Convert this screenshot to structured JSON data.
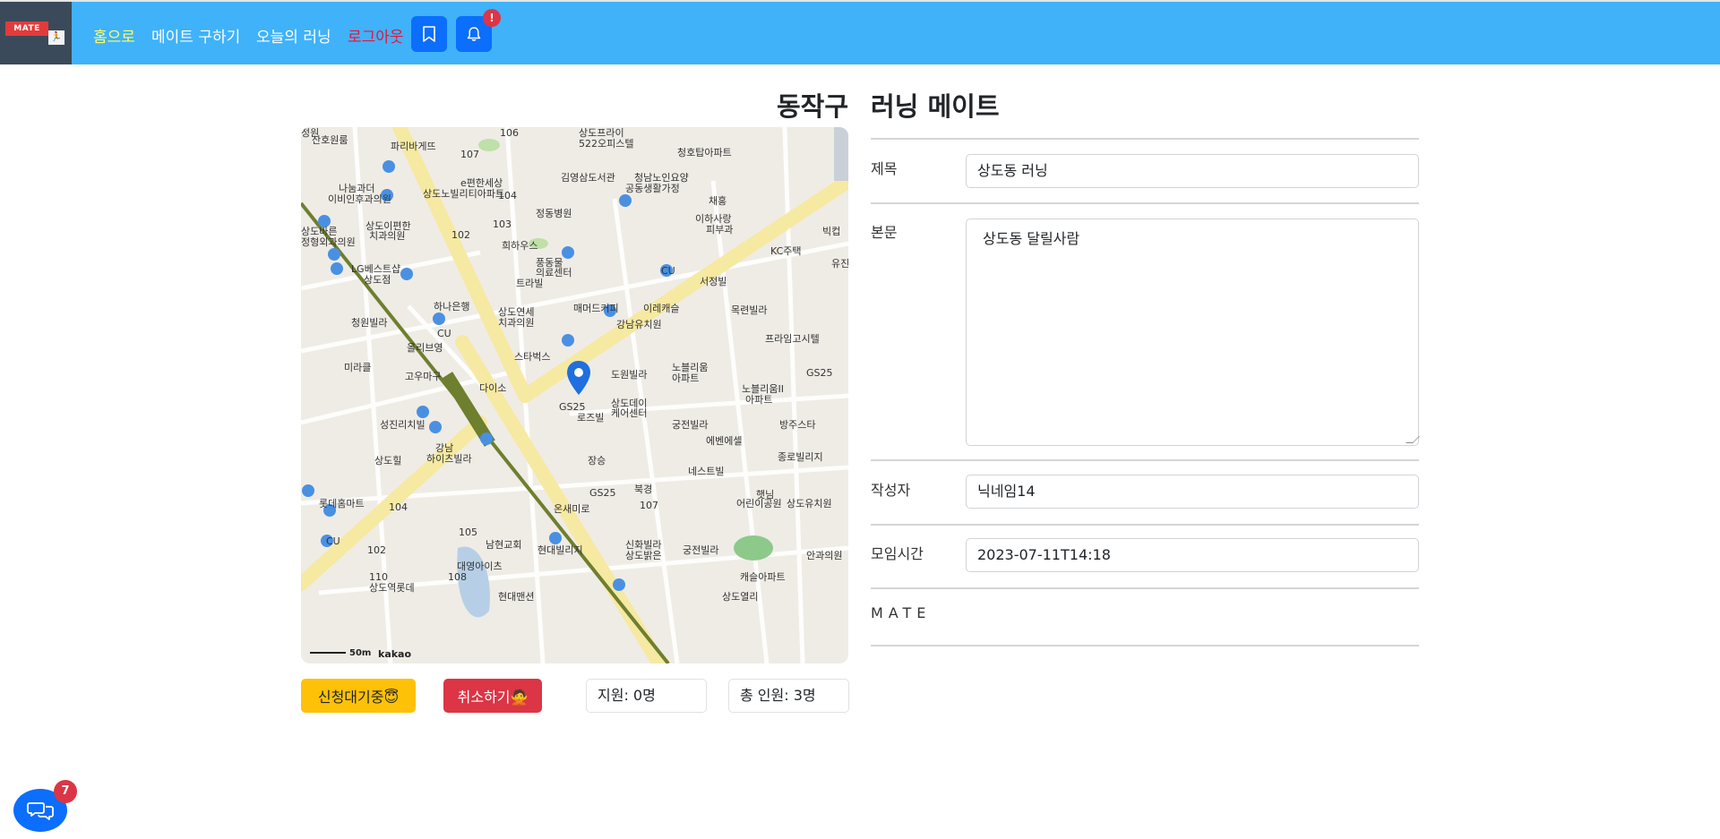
{
  "nav": {
    "logo_text": "MATE",
    "logo_sub": "🏃",
    "home": "홈으로",
    "find_mate": "메이트 구하기",
    "today_running": "오늘의 러닝",
    "logout": "로그아웃",
    "bell_badge": "!"
  },
  "page": {
    "title_left": "동작구",
    "title_right": "러닝 메이트"
  },
  "map": {
    "scale": "50m",
    "provider": "kakao",
    "labels": [
      "산호원룸",
      "파리바게뜨",
      "107",
      "106",
      "상도프라이",
      "522오피스텔",
      "청호탑아파트",
      "나눔과더",
      "이비인후과의원",
      "e편한세상",
      "상도노빌리티아파트",
      "104",
      "김영삼도서관",
      "청남노인요양",
      "공동생활가정",
      "채홍",
      "상도이편한",
      "치과의원",
      "정동병원",
      "이하사랑",
      "피부과",
      "상도바른",
      "정형외과의원",
      "103",
      "102",
      "희하우스",
      "KC주택",
      "빅컵",
      "LG베스트샵",
      "상도점",
      "풍동물",
      "의료센터",
      "CU",
      "서정빌",
      "유진",
      "트라빌",
      "하나은행",
      "상도연세",
      "치과의원",
      "매머드커피",
      "이레캐슬",
      "목련빌라",
      "청원빌라",
      "강남유치원",
      "프라임고시텔",
      "CU",
      "올리브영",
      "스타벅스",
      "미라클",
      "고우마구",
      "도원빌라",
      "노블리움",
      "아파트",
      "GS25",
      "다이소",
      "상도데이",
      "케어센터",
      "노블리움II",
      "아파트",
      "GS25",
      "로즈빌",
      "성진리치빌",
      "궁전빌라",
      "방주스타",
      "에벤에셀",
      "종로빌리지",
      "강남",
      "하이츠빌라",
      "상도힐",
      "장승",
      "네스트빌",
      "GS25",
      "북경",
      "햇님",
      "어린이공원",
      "상도유치원",
      "롯데홈마트",
      "104",
      "107",
      "온새미로",
      "CU",
      "102",
      "105",
      "남현교회",
      "현대빌리지",
      "궁전빌라",
      "신화빌라",
      "상도밝은",
      "안과의원",
      "대영아이츠",
      "108",
      "110",
      "상도역롯데",
      "캐슬아파트",
      "현대맨션",
      "상도열리",
      "정원"
    ]
  },
  "actions": {
    "wait_label": "신청대기중😇",
    "cancel_label": "취소하기🙅",
    "applied": "지원: 0명",
    "total": "총 인원: 3명"
  },
  "form": {
    "title_label": "제목",
    "title_value": "상도동 러닝",
    "body_label": "본문",
    "body_value": "상도동 달릴사람",
    "author_label": "작성자",
    "author_value": "닉네임14",
    "time_label": "모임시간",
    "time_value": "2023-07-11T14:18",
    "footer": "MATE"
  },
  "chat": {
    "badge": "7"
  },
  "colors": {
    "navbar": "#3fb2fa",
    "primary": "#0b6efd",
    "warning": "#ffc107",
    "danger": "#dc3545",
    "road": "#f6e9a2",
    "subway": "#6e7f2e"
  }
}
